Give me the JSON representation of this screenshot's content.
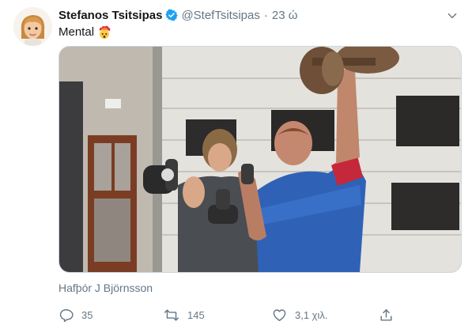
{
  "tweet": {
    "author_name": "Stefanos Tsitsipas",
    "handle": "@StefTsitsipas",
    "separator": "·",
    "time": "23 ώ",
    "text": "Mental",
    "emoji": "exploding-head-emoji"
  },
  "media": {
    "tagged_user": "Hafþór J Björnsson"
  },
  "actions": {
    "reply_count": "35",
    "retweet_count": "145",
    "like_count": "3,1 χιλ."
  },
  "colors": {
    "verified": "#1da1f2",
    "muted_text": "#657786",
    "border": "#ccd6dd"
  }
}
